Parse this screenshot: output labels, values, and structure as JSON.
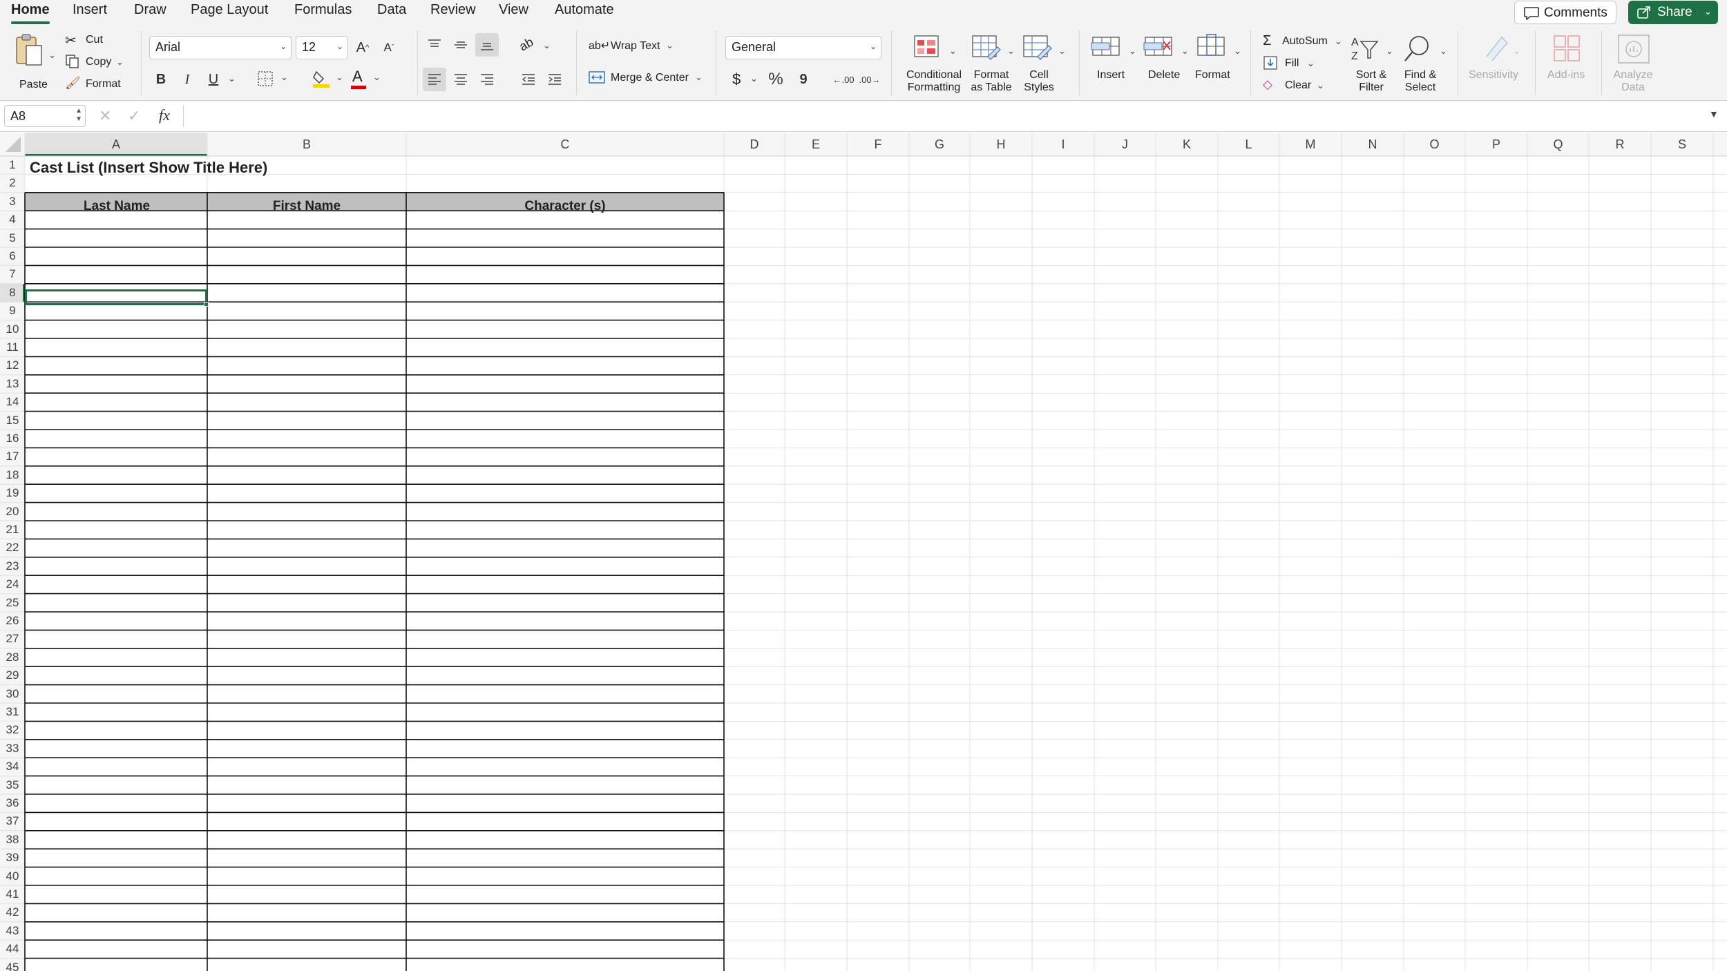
{
  "tabs": [
    {
      "label": "Home",
      "active": true
    },
    {
      "label": "Insert"
    },
    {
      "label": "Draw"
    },
    {
      "label": "Page Layout"
    },
    {
      "label": "Formulas"
    },
    {
      "label": "Data"
    },
    {
      "label": "Review"
    },
    {
      "label": "View"
    },
    {
      "label": "Automate"
    }
  ],
  "top_actions": {
    "comments": "Comments",
    "share": "Share"
  },
  "clipboard": {
    "paste": "Paste",
    "cut": "Cut",
    "copy": "Copy",
    "format": "Format"
  },
  "font": {
    "family": "Arial",
    "size": "12",
    "bold": "B",
    "italic": "I",
    "underline": "U",
    "grow": "A",
    "shrink": "A",
    "color_letter": "A"
  },
  "alignment": {
    "wrap_text": "Wrap Text",
    "merge_center": "Merge & Center"
  },
  "number": {
    "format": "General",
    "currency": "$",
    "percent": "%",
    "comma": "9",
    "inc_decimal": ".00",
    "dec_decimal": ".00"
  },
  "styles": {
    "conditional": "Conditional\nFormatting",
    "format_table": "Format\nas Table",
    "cell_styles": "Cell\nStyles"
  },
  "cells_group": {
    "insert": "Insert",
    "delete": "Delete",
    "format": "Format"
  },
  "editing": {
    "autosum": "AutoSum",
    "fill": "Fill",
    "clear": "Clear",
    "sort_filter": "Sort &\nFilter",
    "find_select": "Find &\nSelect"
  },
  "extras": {
    "sensitivity": "Sensitivity",
    "addins": "Add-ins",
    "analyze": "Analyze\nData"
  },
  "formula_bar": {
    "name_box": "A8",
    "fx": "fx",
    "content": ""
  },
  "colors": {
    "accent": "#1e7145",
    "header_fill": "#bfbfbf",
    "fill_yellow": "#ffd400",
    "font_red": "#e00000"
  },
  "sheet": {
    "columns": [
      "A",
      "B",
      "C",
      "D",
      "E",
      "F",
      "G",
      "H",
      "I",
      "J",
      "K",
      "L",
      "M",
      "N",
      "O",
      "P",
      "Q",
      "R",
      "S"
    ],
    "row_count": 45,
    "selected_cell": "A8",
    "title": "Cast List (Insert Show Title Here)",
    "headers": [
      "Last Name",
      "First Name",
      "Character (s)"
    ]
  }
}
